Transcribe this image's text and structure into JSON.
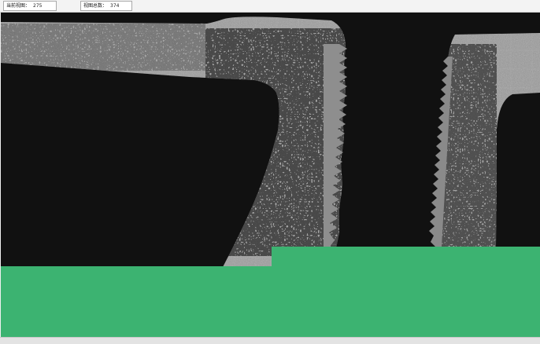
{
  "toolbar": {
    "current_view": {
      "label": "当前视图：",
      "value": "275"
    },
    "total_views": {
      "label": "视图总数：",
      "value": "374"
    }
  },
  "colors": {
    "viewer_background": "#111111",
    "specimen_gray": "#9c9c9c",
    "unscanned_area": "#3cb371"
  }
}
